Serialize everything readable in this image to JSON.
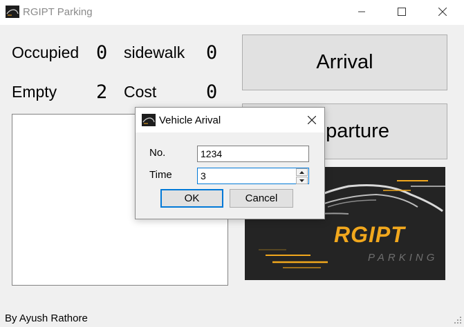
{
  "window": {
    "title": "RGIPT Parking",
    "icon": "parking-app-icon"
  },
  "stats": {
    "occupied_label": "Occupied",
    "occupied_value": "0",
    "sidewalk_label": "sidewalk",
    "sidewalk_value": "0",
    "empty_label": "Empty",
    "empty_value": "2",
    "cost_label": "Cost",
    "cost_value": "0"
  },
  "buttons": {
    "arrival": "Arrival",
    "departure": "Departure"
  },
  "logo": {
    "title": "RGIPT",
    "subtitle": "PARKING",
    "accent": "#f2a81d"
  },
  "footer": {
    "author": "By Ayush Rathore"
  },
  "dialog": {
    "title": "Vehicle Arival",
    "no_label": "No.",
    "no_value": "1234",
    "time_label": "Time",
    "time_value": "3",
    "ok_label": "OK",
    "cancel_label": "Cancel"
  },
  "colors": {
    "focus": "#0078d7",
    "background": "#f0f0f0"
  }
}
